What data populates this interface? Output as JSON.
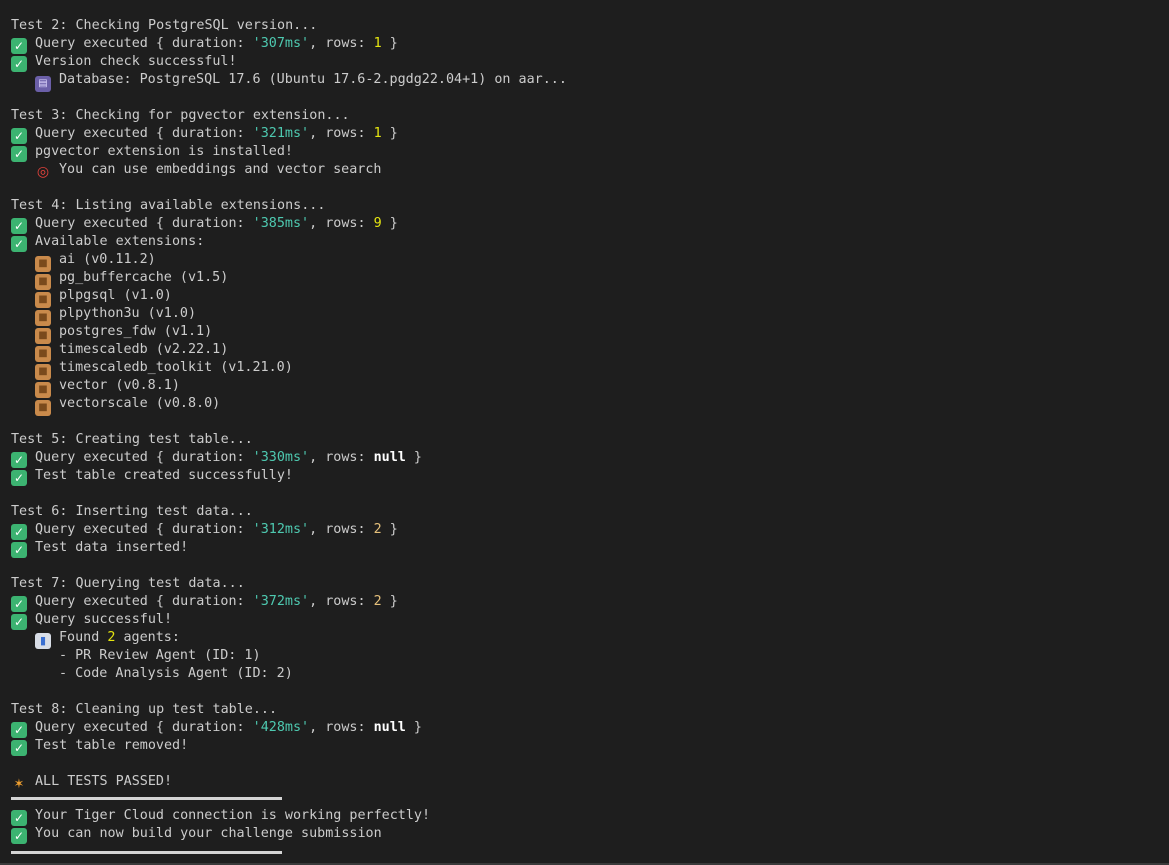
{
  "test2": {
    "title": "Test 2: Checking PostgreSQL version...",
    "query_prefix": "Query executed { duration: ",
    "duration": "'307ms'",
    "rows_label": ", rows: ",
    "rows": "1",
    "close": " }",
    "ok": "Version check successful!",
    "detail": "Database: PostgreSQL 17.6 (Ubuntu 17.6-2.pgdg22.04+1) on aar..."
  },
  "test3": {
    "title": "Test 3: Checking for pgvector extension...",
    "query_prefix": "Query executed { duration: ",
    "duration": "'321ms'",
    "rows_label": ", rows: ",
    "rows": "1",
    "close": " }",
    "ok": "pgvector extension is installed!",
    "detail": "You can use embeddings and vector search"
  },
  "test4": {
    "title": "Test 4: Listing available extensions...",
    "query_prefix": "Query executed { duration: ",
    "duration": "'385ms'",
    "rows_label": ", rows: ",
    "rows": "9",
    "close": " }",
    "ok": "Available extensions:",
    "extensions": [
      "ai (v0.11.2)",
      "pg_buffercache (v1.5)",
      "plpgsql (v1.0)",
      "plpython3u (v1.0)",
      "postgres_fdw (v1.1)",
      "timescaledb (v2.22.1)",
      "timescaledb_toolkit (v1.21.0)",
      "vector (v0.8.1)",
      "vectorscale (v0.8.0)"
    ]
  },
  "test5": {
    "title": "Test 5: Creating test table...",
    "query_prefix": "Query executed { duration: ",
    "duration": "'330ms'",
    "rows_label": ", rows: ",
    "rows": "null",
    "close": " }",
    "ok": "Test table created successfully!"
  },
  "test6": {
    "title": "Test 6: Inserting test data...",
    "query_prefix": "Query executed { duration: ",
    "duration": "'312ms'",
    "rows_label": ", rows: ",
    "rows": "2",
    "close": " }",
    "ok": "Test data inserted!"
  },
  "test7": {
    "title": "Test 7: Querying test data...",
    "query_prefix": "Query executed { duration: ",
    "duration": "'372ms'",
    "rows_label": ", rows: ",
    "rows": "2",
    "close": " }",
    "ok": "Query successful!",
    "found_prefix": "Found ",
    "found_count": "2",
    "found_suffix": " agents:",
    "agents": [
      "- PR Review Agent (ID: 1)",
      "- Code Analysis Agent (ID: 2)"
    ]
  },
  "test8": {
    "title": "Test 8: Cleaning up test table...",
    "query_prefix": "Query executed { duration: ",
    "duration": "'428ms'",
    "rows_label": ", rows: ",
    "rows": "null",
    "close": " }",
    "ok": "Test table removed!"
  },
  "summary": {
    "all_passed": "ALL TESTS PASSED!",
    "msg1": "Your Tiger Cloud connection is working perfectly!",
    "msg2": "You can now build your challenge submission"
  },
  "icons": {
    "check": "check-mark-icon",
    "package": "package-icon",
    "database": "database-icon",
    "target": "target-icon",
    "chart": "bar-chart-icon",
    "party": "party-popper-icon"
  },
  "colors": {
    "background": "#1e1e1e",
    "text": "#cccccc",
    "string": "#4ec9b0",
    "number": "#e5e510",
    "check_green": "#3cb371"
  }
}
